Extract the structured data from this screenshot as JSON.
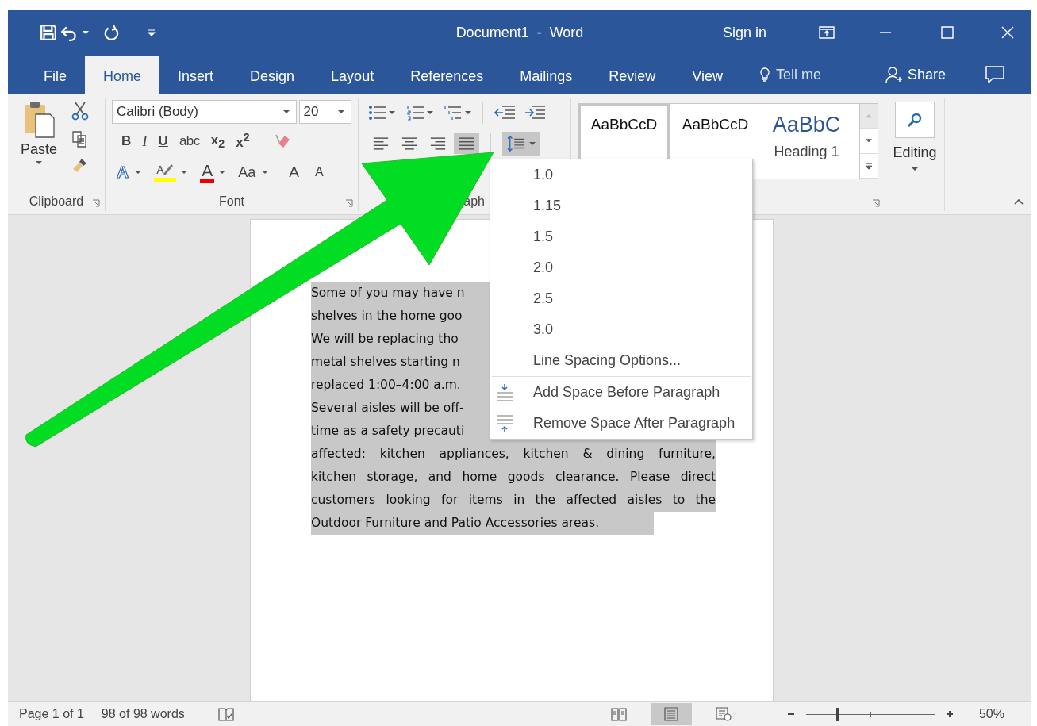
{
  "window": {
    "title": "Document1  -  Word",
    "sign_in": "Sign in"
  },
  "tabs": [
    {
      "label": "File",
      "selected": false
    },
    {
      "label": "Home",
      "selected": true
    },
    {
      "label": "Insert",
      "selected": false
    },
    {
      "label": "Design",
      "selected": false
    },
    {
      "label": "Layout",
      "selected": false
    },
    {
      "label": "References",
      "selected": false
    },
    {
      "label": "Mailings",
      "selected": false
    },
    {
      "label": "Review",
      "selected": false
    },
    {
      "label": "View",
      "selected": false
    }
  ],
  "tell_me": {
    "placeholder": "Tell me"
  },
  "share": {
    "label": "Share"
  },
  "clipboard": {
    "paste": "Paste",
    "label": "Clipboard"
  },
  "font": {
    "family": "Calibri (Body)",
    "size": "20",
    "format_buttons": [
      {
        "label": "B",
        "kind": "bold"
      },
      {
        "label": "I",
        "kind": "italic"
      },
      {
        "label": "U",
        "kind": "underline"
      },
      {
        "label": "abc",
        "kind": "strike"
      },
      {
        "label": "x$_{2}$",
        "kind": "script"
      },
      {
        "label": "x$^{2}$",
        "kind": "script"
      }
    ],
    "text_effects": "A",
    "font_color": "A",
    "change_case": "Aa",
    "grow": "A",
    "shrink": "A",
    "label": "Font"
  },
  "paragraph": {
    "alignments": [
      {
        "kind": "left",
        "selected": false
      },
      {
        "kind": "center",
        "selected": false
      },
      {
        "kind": "right",
        "selected": false
      },
      {
        "kind": "justify",
        "selected": true
      }
    ],
    "line_spacing_open": true,
    "label": "aph"
  },
  "styles": {
    "items": [
      {
        "sample": "AaBbCcD",
        "kind": "body",
        "selected": true
      },
      {
        "sample": "AaBbCcD",
        "kind": "body",
        "selected": false
      },
      {
        "sample": "AaBbC",
        "kind": "heading",
        "name": "Heading 1",
        "selected": false
      }
    ]
  },
  "editing": {
    "label": "Editing"
  },
  "line_spacing_menu": {
    "options": [
      {
        "label": "1.0"
      },
      {
        "label": "1.15"
      },
      {
        "label": "1.5"
      },
      {
        "label": "2.0"
      },
      {
        "label": "2.5"
      },
      {
        "label": "3.0"
      }
    ],
    "more": "Line Spacing Options...",
    "actions": [
      {
        "kind": "add_before",
        "label": "Add Space Before Paragraph"
      },
      {
        "kind": "remove_after",
        "label": "Remove Space After Paragraph"
      }
    ]
  },
  "document": {
    "lines": [
      {
        "text": "Some of you may have n",
        "justified": false
      },
      {
        "text": "shelves in the home goo",
        "justified": false
      },
      {
        "text": "We will be replacing tho",
        "justified": false
      },
      {
        "text": "metal shelves starting n",
        "justified": false
      },
      {
        "text": "replaced 1:00–4:00 a.m.",
        "justified": false
      },
      {
        "text": "Several aisles will be off-",
        "justified": false
      },
      {
        "text": "time as a safety precauti",
        "justified": false
      },
      {
        "text": "affected: kitchen appliances, kitchen & dining furniture,",
        "justified": true
      },
      {
        "text": "kitchen storage, and home goods clearance. Please direct",
        "justified": true
      },
      {
        "text": "customers looking for items in the affected aisles to the",
        "justified": true
      },
      {
        "text": "Outdoor Furniture and Patio Accessories areas.",
        "justified": false
      }
    ]
  },
  "status_bar": {
    "page": "Page 1 of 1",
    "words": "98 of 98 words",
    "views": [
      {
        "kind": "read",
        "selected": false
      },
      {
        "kind": "print",
        "selected": true
      },
      {
        "kind": "web",
        "selected": false
      }
    ],
    "zoom": {
      "level": 0.25,
      "reading": "50%"
    }
  }
}
